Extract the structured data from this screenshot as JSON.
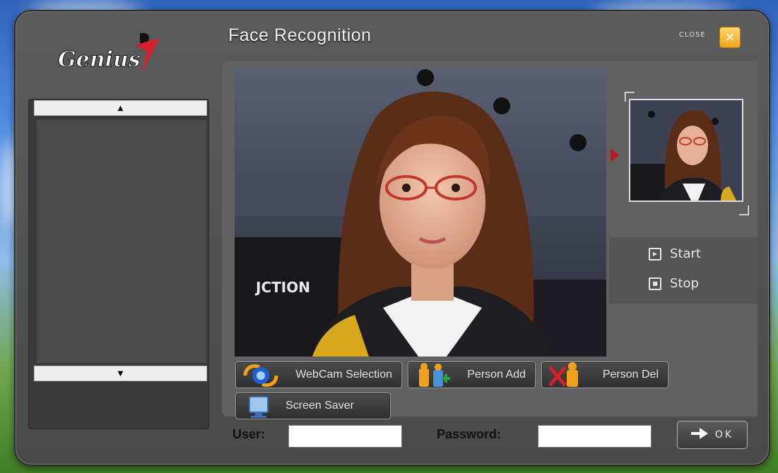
{
  "window": {
    "brand": "Genius",
    "title": "Face Recognition",
    "close_label": "CLOSE",
    "close_symbol": "✕"
  },
  "list": {
    "scroll_up_symbol": "▲",
    "scroll_down_symbol": "▼"
  },
  "video": {
    "background_sign": "JCTION"
  },
  "controls": {
    "start_label": "Start",
    "stop_label": "Stop"
  },
  "toolbar": {
    "webcam_label": "WebCam Selection",
    "person_add_label": "Person Add",
    "person_del_label": "Person Del",
    "screen_saver_label": "Screen Saver"
  },
  "login": {
    "user_label": "User:",
    "user_value": "",
    "password_label": "Password:",
    "password_value": "",
    "ok_label": "OK"
  },
  "colors": {
    "accent_orange": "#f0a11c",
    "pointer_red": "#b01d2a",
    "window_bg": "#4a4a4a"
  },
  "icons": [
    "close-icon",
    "up-arrow-icon",
    "down-arrow-icon",
    "play-icon",
    "stop-icon",
    "webcam-icon",
    "person-add-icon",
    "person-del-icon",
    "monitor-icon",
    "arrow-right-icon"
  ]
}
